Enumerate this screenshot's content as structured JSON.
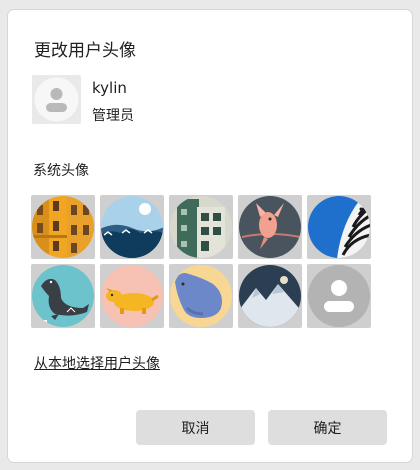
{
  "dialog": {
    "title": "更改用户头像",
    "user": {
      "name": "kylin",
      "role": "管理员"
    },
    "section_label": "系统头像",
    "avatars": [
      {
        "name": "avatar-yellow-building"
      },
      {
        "name": "avatar-ocean-wave"
      },
      {
        "name": "avatar-green-building"
      },
      {
        "name": "avatar-pink-bird"
      },
      {
        "name": "avatar-zebra"
      },
      {
        "name": "avatar-seal"
      },
      {
        "name": "avatar-yellow-dog"
      },
      {
        "name": "avatar-blue-creature"
      },
      {
        "name": "avatar-snow-mountain"
      },
      {
        "name": "avatar-default-user"
      }
    ],
    "local_link": "从本地选择用户头像",
    "cancel_label": "取消",
    "ok_label": "确定"
  },
  "colors": {
    "button_bg": "#dedede",
    "cell_bg": "#cfcfcf",
    "dialog_bg": "#ffffff"
  }
}
